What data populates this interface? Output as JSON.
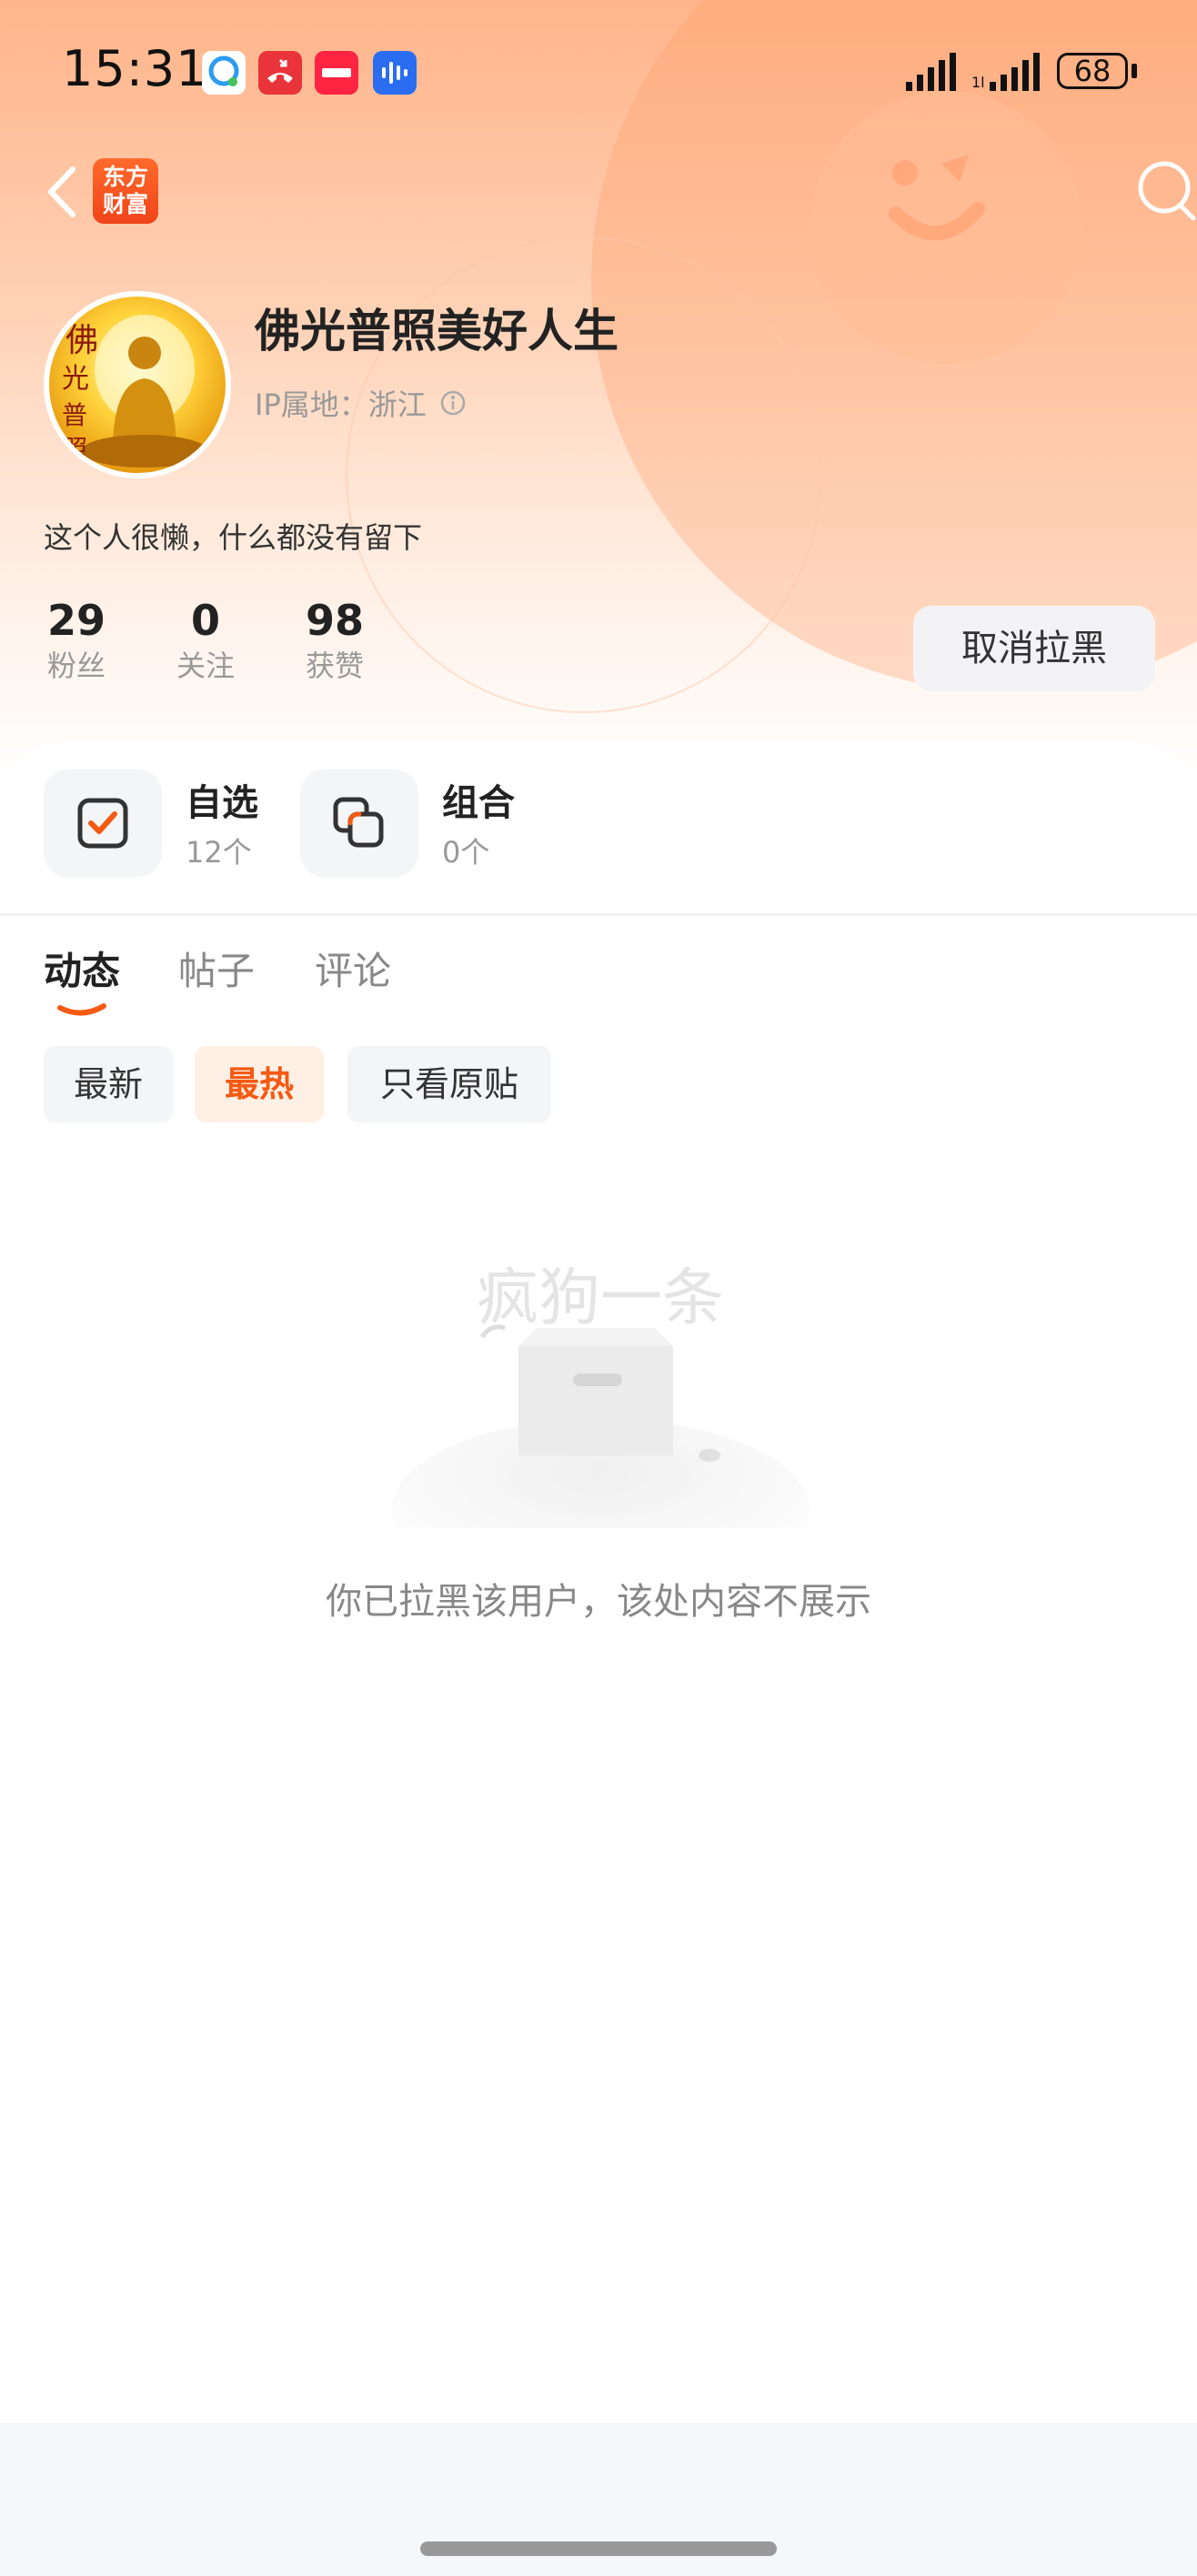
{
  "status_bar": {
    "time": "15:31",
    "battery": "68",
    "notification_icons": [
      "message-app-icon",
      "phone-missed-icon",
      "xiaohongshu-icon",
      "voice-app-icon"
    ]
  },
  "nav": {
    "app_logo_line1": "东方",
    "app_logo_line2": "财富"
  },
  "profile": {
    "name": "佛光普照美好人生",
    "ip_location": "IP属地：浙江",
    "bio": "这个人很懒，什么都没有留下",
    "stats": [
      {
        "value": "29",
        "label": "粉丝"
      },
      {
        "value": "0",
        "label": "关注"
      },
      {
        "value": "98",
        "label": "获赞"
      }
    ],
    "unblock_label": "取消拉黑"
  },
  "entries": {
    "watchlist": {
      "title": "自选",
      "sub": "12个"
    },
    "portfolio": {
      "title": "组合",
      "sub": "0个"
    }
  },
  "tabs": [
    {
      "label": "动态",
      "active": true
    },
    {
      "label": "帖子",
      "active": false
    },
    {
      "label": "评论",
      "active": false
    }
  ],
  "filters": [
    {
      "label": "最新",
      "active": false
    },
    {
      "label": "最热",
      "active": true
    },
    {
      "label": "只看原贴",
      "active": false
    }
  ],
  "empty_state": {
    "watermark": "疯狗一条",
    "message": "你已拉黑该用户，该处内容不展示"
  },
  "colors": {
    "accent": "#f55a12",
    "header_top": "#ffb48a"
  }
}
